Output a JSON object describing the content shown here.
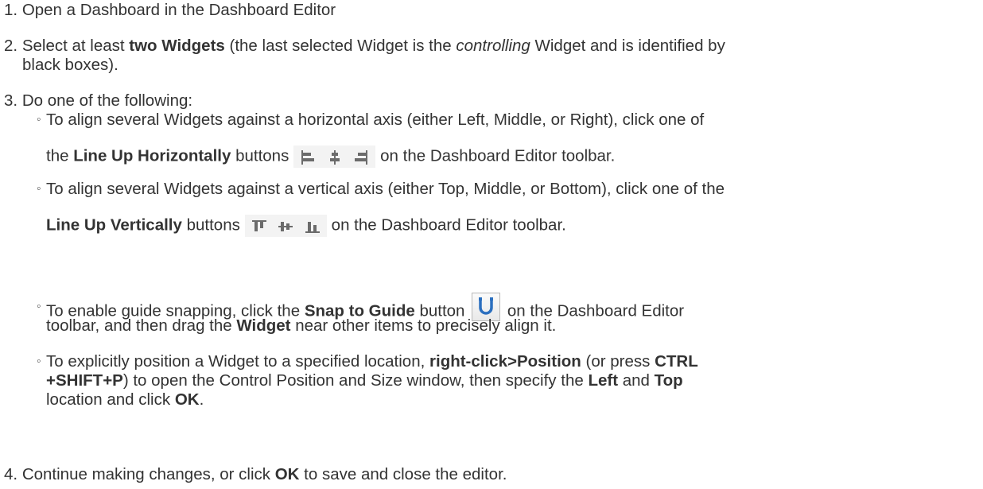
{
  "steps": [
    {
      "number": "1.",
      "text": "Open a Dashboard in the Dashboard Editor"
    },
    {
      "number": "2.",
      "text_a": "Select at least ",
      "bold_a": "two Widgets",
      "text_b": " (the last selected Widget is the ",
      "italic_a": "controlling",
      "text_c": " Widget and is identified by",
      "text_d": "black boxes)."
    },
    {
      "number": "3.",
      "text": "Do one of the following:"
    },
    {
      "number": "4.",
      "text_a": "Continue making changes, or click ",
      "bold_a": "OK",
      "text_b": " to save and close the editor."
    }
  ],
  "bullets": [
    {
      "marker": "◦",
      "line1": "To align several Widgets against a horizontal axis (either Left, Middle, or Right), click one of",
      "line2_a": "the ",
      "line2_bold": "Line Up Horizontally",
      "line2_b": " buttons",
      "line2_c": " on the Dashboard Editor toolbar.",
      "icons": [
        "align-left-icon",
        "align-center-icon",
        "align-right-icon"
      ]
    },
    {
      "marker": "◦",
      "line1": "To align several Widgets against a vertical axis (either Top, Middle, or Bottom), click one of the",
      "line2_bold": "Line Up Vertically",
      "line2_b": " buttons",
      "line2_c": " on the Dashboard Editor toolbar.",
      "icons": [
        "align-top-icon",
        "align-middle-icon",
        "align-bottom-icon"
      ]
    },
    {
      "marker": "◦",
      "line1_a": "To enable guide snapping, click the ",
      "line1_bold": "Snap to Guide",
      "line1_b": " button",
      "line1_c": " on the Dashboard Editor",
      "line2_a": "toolbar, and then drag the ",
      "line2_bold": "Widget",
      "line2_b": " near other items to precisely align it.",
      "icon": "magnet-icon"
    },
    {
      "marker": "◦",
      "line1_a": "To explicitly position a Widget to a specified location, ",
      "line1_bold": "right-click>Position",
      "line1_b": " (or press ",
      "line1_bold2": "CTRL",
      "line2_bold": "+SHIFT+P",
      "line2_a": ") to open the Control Position and Size window, then specify the ",
      "line2_bold2": "Left",
      "line2_b": " and ",
      "line2_bold3": "Top",
      "line3_a": "location and click ",
      "line3_bold": "OK",
      "line3_b": "."
    }
  ]
}
